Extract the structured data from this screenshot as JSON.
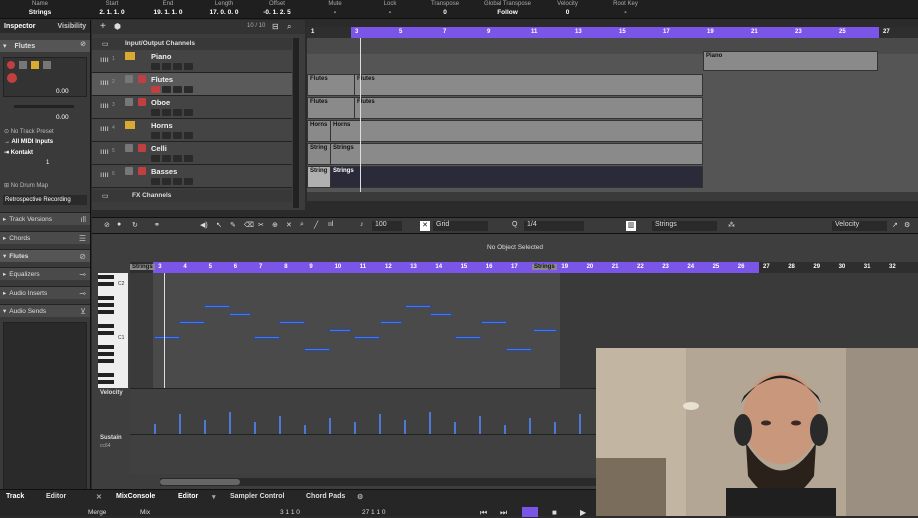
{
  "info_line": [
    {
      "label": "Name",
      "value": "Strings"
    },
    {
      "label": "Start",
      "value": "2. 1. 1.  0"
    },
    {
      "label": "End",
      "value": "19. 1. 1.  0"
    },
    {
      "label": "Length",
      "value": "17. 0. 0.  0"
    },
    {
      "label": "Offset",
      "value": "-0. 1. 2.  5"
    },
    {
      "label": "Mute",
      "value": "-"
    },
    {
      "label": "Lock",
      "value": "-"
    },
    {
      "label": "Transpose",
      "value": "0"
    },
    {
      "label": "Global Transpose",
      "value": "Follow"
    },
    {
      "label": "Velocity",
      "value": "0"
    },
    {
      "label": "Root Key",
      "value": "-"
    }
  ],
  "inspector": {
    "tab_inspector": "Inspector",
    "tab_visibility": "Visibility",
    "track_name": "Flutes",
    "value_1": "0.00",
    "value_2": "0.00",
    "no_track_preset": "No Track Preset",
    "all_midi_inputs": "All MIDI Inputs",
    "instrument": "Kontakt",
    "channel": "1",
    "no_drum_map": "No Drum Map",
    "retro_recording": "Retrospective Recording",
    "sections": [
      "Track Versions",
      "Chords",
      "Flutes",
      "Equalizers",
      "Audio Inserts",
      "Audio Sends"
    ]
  },
  "tracklist": {
    "counter": "10 / 10",
    "folder": "Input/Output Channels",
    "tracks": [
      {
        "num": "1",
        "name": "Piano"
      },
      {
        "num": "2",
        "name": "Flutes"
      },
      {
        "num": "3",
        "name": "Oboe"
      },
      {
        "num": "4",
        "name": "Horns"
      },
      {
        "num": "5",
        "name": "Celli"
      },
      {
        "num": "6",
        "name": "Basses"
      }
    ],
    "fx": "FX Channels"
  },
  "ruler_top": [
    "1",
    "3",
    "5",
    "7",
    "9",
    "11",
    "13",
    "15",
    "17",
    "19",
    "21",
    "23",
    "25",
    "27"
  ],
  "parts": [
    {
      "label": "Piano"
    },
    {
      "label": "Flutes"
    },
    {
      "label": "Flutes"
    },
    {
      "label": "Flutes"
    },
    {
      "label": "Flutes"
    },
    {
      "label": "Horns"
    },
    {
      "label": "Horns"
    },
    {
      "label": "String"
    },
    {
      "label": "Strings"
    },
    {
      "label": "String"
    },
    {
      "label": "Strings"
    }
  ],
  "editor_toolbar": {
    "quantize_value": "100",
    "grid_label": "Grid",
    "quantize": "1/4",
    "part_select": "Strings",
    "lane": "Velocity"
  },
  "no_object": "No Object Selected",
  "ruler_editor": [
    "Strings",
    "3",
    "4",
    "5",
    "6",
    "7",
    "8",
    "9",
    "10",
    "11",
    "12",
    "13",
    "14",
    "15",
    "16",
    "17",
    "Strings",
    "19",
    "20",
    "21",
    "22",
    "23",
    "24",
    "25",
    "26",
    "27",
    "28",
    "29",
    "30",
    "31",
    "32"
  ],
  "piano_labels": [
    "C2",
    "C1"
  ],
  "lanes": {
    "velocity": "Velocity",
    "sustain": "Sustain",
    "sustain_cc": "cc64"
  },
  "bottom": {
    "tabs": [
      "Track",
      "Editor",
      "MixConsole",
      "Editor",
      "Sampler Control",
      "Chord Pads"
    ],
    "merge": "Merge",
    "mix": "Mix",
    "pos_left": "3  1  1  0",
    "pos_right": "27  1  1  0"
  },
  "colors": {
    "ruler_purple": "#7a55e8",
    "note_blue": "#4f77d6",
    "part_grey": "#8a8a8a"
  }
}
